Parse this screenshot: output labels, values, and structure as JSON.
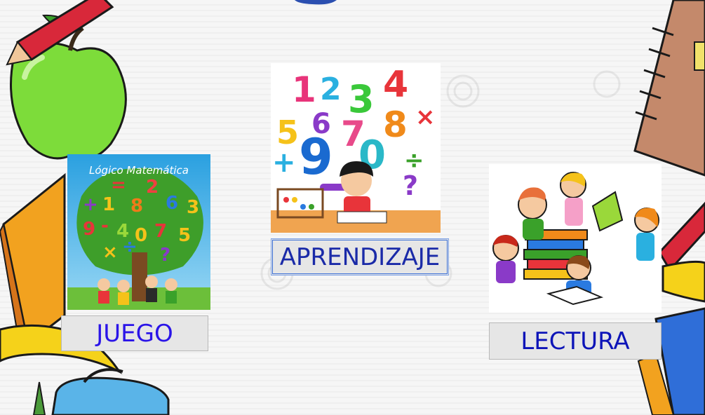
{
  "background": {
    "color": "#f4f4f4",
    "decorations": [
      "apple-icon",
      "pencil-icon",
      "book-icon",
      "notebook-icon",
      "banana-icon",
      "lunchbox-icon"
    ]
  },
  "cards": [
    {
      "id": "juego",
      "button_label": "JUEGO",
      "button_color": "#2a14e8",
      "image_caption": "Lógico Matemática",
      "image_numbers": [
        "=",
        "2",
        "+",
        "1",
        "8",
        "6",
        "3",
        "9",
        "-",
        "4",
        "0",
        "7",
        "5",
        "×",
        "÷",
        "?"
      ]
    },
    {
      "id": "aprendizaje",
      "button_label": "APRENDIZAJE",
      "button_color": "#1a2aa8",
      "image_numbers": [
        "1",
        "2",
        "3",
        "4",
        "5",
        "6",
        "7",
        "8",
        "×",
        "+",
        "9",
        "0",
        "÷",
        "-",
        "?"
      ]
    },
    {
      "id": "lectura",
      "button_label": "LECTURA",
      "button_color": "#0d14b8"
    }
  ]
}
